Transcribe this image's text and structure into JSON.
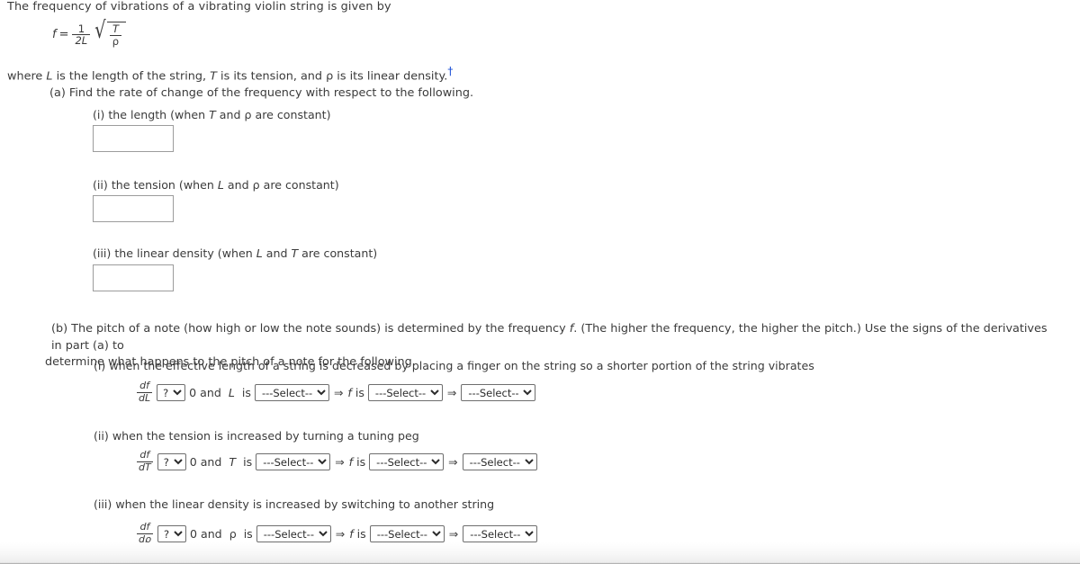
{
  "intro": {
    "line1": "The frequency of vibrations of a vibrating violin string is given by",
    "where_prefix": "where ",
    "where_L": "L",
    "where_mid1": " is the length of the string, ",
    "where_T": "T",
    "where_mid2": " is its tension, and ",
    "where_rho": "ρ",
    "where_suffix": " is its linear density.",
    "dagger": "†"
  },
  "formula": {
    "f": "f",
    "equals": "=",
    "coef_num": "1",
    "coef_den": "2L",
    "radical_sign": "√",
    "rad_num": "T",
    "rad_den": "ρ"
  },
  "part_a": {
    "label": "(a) Find the rate of change of the frequency with respect to the following.",
    "items": [
      {
        "label_pre": "(i) the length (when ",
        "var1": "T",
        "label_mid": " and ",
        "var2": "ρ",
        "label_post": " are constant)",
        "answer_value": "",
        "answer_placeholder": ""
      },
      {
        "label_pre": "(ii) the tension (when ",
        "var1": "L",
        "label_mid": " and ",
        "var2": "ρ",
        "label_post": " are constant)",
        "answer_value": "",
        "answer_placeholder": ""
      },
      {
        "label_pre": "(iii) the linear density (when ",
        "var1": "L",
        "label_mid": " and ",
        "var2": "T",
        "label_post": " are constant)",
        "answer_value": "",
        "answer_placeholder": ""
      }
    ]
  },
  "part_b": {
    "text_1": "(b) The pitch of a note (how high or low the note sounds) is determined by the frequency ",
    "text_f": "f",
    "text_2": ". (The higher the frequency, the higher the pitch.) Use the signs of the derivatives in part (a) to",
    "text_3": "determine what happens to the pitch of a note for the following.",
    "items": [
      {
        "prompt": "(i) when the effective length of a string is decreased by placing a finger on the string so a shorter portion of the string vibrates",
        "deriv_num": "df",
        "deriv_den": "dL",
        "sign_select": "?",
        "after_sign": "0 and",
        "var": "L",
        "is_word": "is",
        "select_1": "---Select---",
        "implies_1": "⇒",
        "f_label": "f",
        "f_is": "is",
        "select_2": "---Select---",
        "implies_2": "⇒",
        "select_3": "---Select---"
      },
      {
        "prompt": "(ii) when the tension is increased by turning a tuning peg",
        "deriv_num": "df",
        "deriv_den": "dT",
        "sign_select": "?",
        "after_sign": "0 and",
        "var": "T",
        "is_word": "is",
        "select_1": "---Select---",
        "implies_1": "⇒",
        "f_label": "f",
        "f_is": "is",
        "select_2": "---Select---",
        "implies_2": "⇒",
        "select_3": "---Select---"
      },
      {
        "prompt": "(iii) when the linear density is increased by switching to another string",
        "deriv_num": "df",
        "deriv_den": "dρ",
        "sign_select": "?",
        "after_sign": "0 and",
        "var": "ρ",
        "is_word": "is",
        "select_1": "---Select---",
        "implies_1": "⇒",
        "f_label": "f",
        "f_is": "is",
        "select_2": "---Select---",
        "implies_2": "⇒",
        "select_3": "---Select---"
      }
    ]
  },
  "colors": {
    "text": "#3a3a3a",
    "dagger": "#1a4fd6",
    "input_border": "#9c9c9c",
    "select_border": "#6e6e6e",
    "background": "#ffffff"
  }
}
